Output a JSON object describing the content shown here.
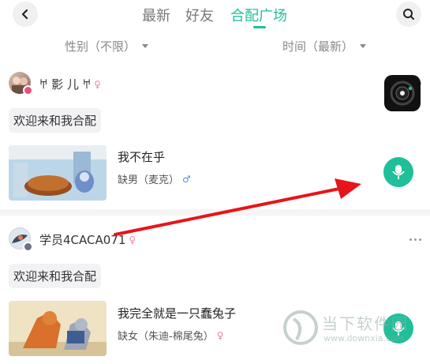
{
  "header": {
    "tabs": [
      {
        "label": "最新",
        "active": false
      },
      {
        "label": "好友",
        "active": false
      },
      {
        "label": "合配广场",
        "active": true
      }
    ]
  },
  "filters": {
    "gender": "性别（不限）",
    "time": "时间（最新）"
  },
  "posts": [
    {
      "username": "𐀀 影 儿 𐀀",
      "gender_symbol": "♀",
      "invite_text": "欢迎来和我合配",
      "song_title": "我不在乎",
      "role_text": "缺男（麦克）",
      "role_symbol": "♂"
    },
    {
      "username": "学员4CACA071",
      "gender_symbol": "♀",
      "invite_text": "欢迎来和我合配",
      "song_title": "我完全就是一只蠢兔子",
      "role_text": "缺女（朱迪-棉尾兔）",
      "role_symbol": "♀"
    }
  ],
  "watermark": {
    "text": "当下软件园",
    "url": "www.downxia.com"
  },
  "colors": {
    "accent": "#1fbf9a",
    "female": "#ef7fb5",
    "male": "#4a8fe0",
    "annotation_arrow": "#e8141b"
  },
  "icons": {
    "back": "chevron-left-icon",
    "search": "search-icon",
    "mic": "microphone-icon",
    "more": "more-dots-icon",
    "player": "floating-player-icon"
  }
}
